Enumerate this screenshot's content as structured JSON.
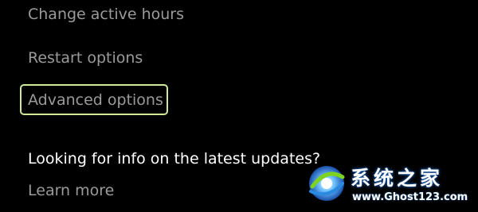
{
  "update_options": {
    "active_hours_label": "Change active hours",
    "restart_options_label": "Restart options",
    "advanced_options_label": "Advanced options"
  },
  "latest_updates": {
    "heading": "Looking for info on the latest updates?",
    "learn_more_label": "Learn more"
  },
  "watermark": {
    "title": "系统之家",
    "url": "www.Ghost123.com"
  },
  "colors": {
    "background": "#000000",
    "link_text": "#9a9a9a",
    "heading_text": "#ffffff",
    "focus_ring": "#cfe89a"
  }
}
